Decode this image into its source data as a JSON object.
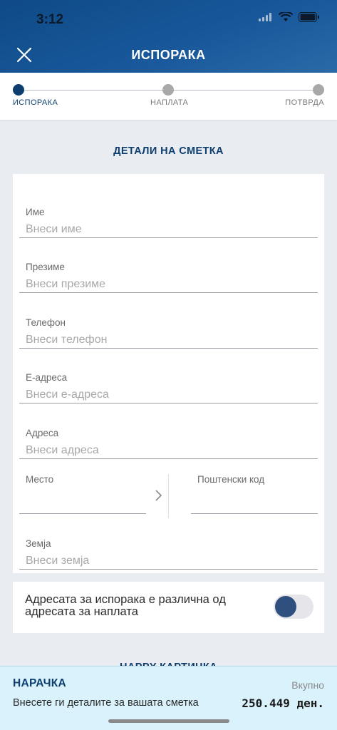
{
  "status_bar": {
    "time": "3:12"
  },
  "header": {
    "title": "ИСПОРАКА"
  },
  "steps": [
    {
      "label": "ИСПОРАКА",
      "state": "active"
    },
    {
      "label": "НАПЛАТА",
      "state": "inactive"
    },
    {
      "label": "ПОТВРДА",
      "state": "inactive"
    }
  ],
  "section": {
    "title": "ДЕТАЛИ НА СМЕТКА"
  },
  "form": {
    "first_name": {
      "label": "Име",
      "placeholder": "Внеси име",
      "value": ""
    },
    "last_name": {
      "label": "Презиме",
      "placeholder": "Внеси презиме",
      "value": ""
    },
    "phone": {
      "label": "Телефон",
      "placeholder": "Внеси телефон",
      "value": ""
    },
    "email": {
      "label": "Е-адреса",
      "placeholder": "Внеси е-адреса",
      "value": ""
    },
    "address": {
      "label": "Адреса",
      "placeholder": "Внеси адреса",
      "value": ""
    },
    "city": {
      "label": "Место",
      "value": ""
    },
    "postal": {
      "label": "Поштенски код",
      "value": ""
    },
    "country": {
      "label": "Земја",
      "placeholder": "Внеси земја",
      "value": ""
    }
  },
  "toggle": {
    "label": "Адресата за испорака е различна од адресата за наплата",
    "on": false
  },
  "next_section": {
    "title": "HAPPY КАРТИЧКА"
  },
  "bottom": {
    "order_title": "НАРАЧКА",
    "order_sub": "Внесете ги деталите за вашата сметка",
    "total_label": "Вкупно",
    "total_value": "250.449 ден."
  },
  "colors": {
    "primary": "#0d3e6e",
    "header": "#17579a",
    "bottom_bg": "#d9f2fb"
  }
}
